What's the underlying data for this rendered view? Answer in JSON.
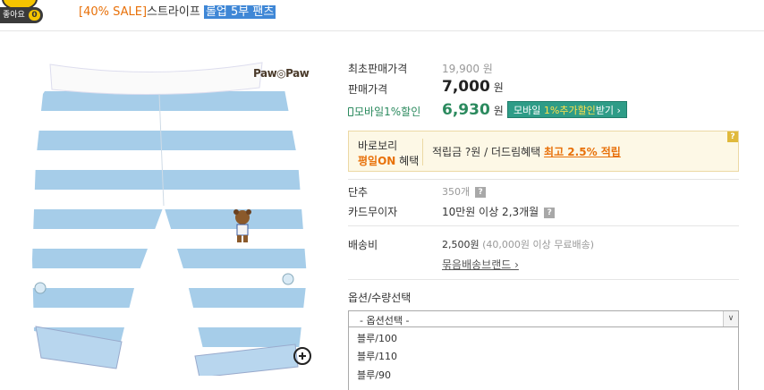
{
  "header": {
    "like_label": "좋아요",
    "like_count": "0",
    "title_sale": "[40% SALE]",
    "title_name": "스트라이프",
    "title_selected": "롤업 5부 팬츠"
  },
  "image": {
    "brand_logo": "Paw◎Paw",
    "zoom_icon": "plus-circle-icon"
  },
  "pricing": {
    "lowest_label": "최초판매가격",
    "lowest_value": "19,900 원",
    "sale_label": "판매가격",
    "sale_value": "7,000",
    "sale_unit": "원",
    "mobile_label": "모바일1%할인",
    "mobile_value": "6,930",
    "mobile_unit": "원",
    "mobile_btn_prefix": "모바일",
    "mobile_btn_highlight": "1%추가할인",
    "mobile_btn_suffix": "받기 ›"
  },
  "benefit": {
    "line1": "바로보리",
    "line2_highlight": "평일ON",
    "line2_rest": "혜택",
    "desc_prefix": "적립금 ?원 / 더드림혜택",
    "desc_highlight": "최고 2.5% 적립",
    "help": "?"
  },
  "details": {
    "stock_label": "단추",
    "stock_value": "350개",
    "card_label": "카드무이자",
    "card_value": "10만원 이상 2,3개월",
    "ship_label": "배송비",
    "ship_value": "2,500원",
    "ship_note": "(40,000원 이상 무료배송)",
    "bundle_link": "묶음배송브랜드 ›",
    "help": "?"
  },
  "options": {
    "label": "옵션/수량선택",
    "placeholder": "- 옵션선택 -",
    "items": [
      "블루/100",
      "블루/110",
      "블루/90"
    ]
  },
  "colors": {
    "sale_orange": "#e8710a",
    "mobile_green": "#2b8a5e",
    "stripe_blue": "#a6cde9",
    "select_highlight": "#3f87d6"
  }
}
